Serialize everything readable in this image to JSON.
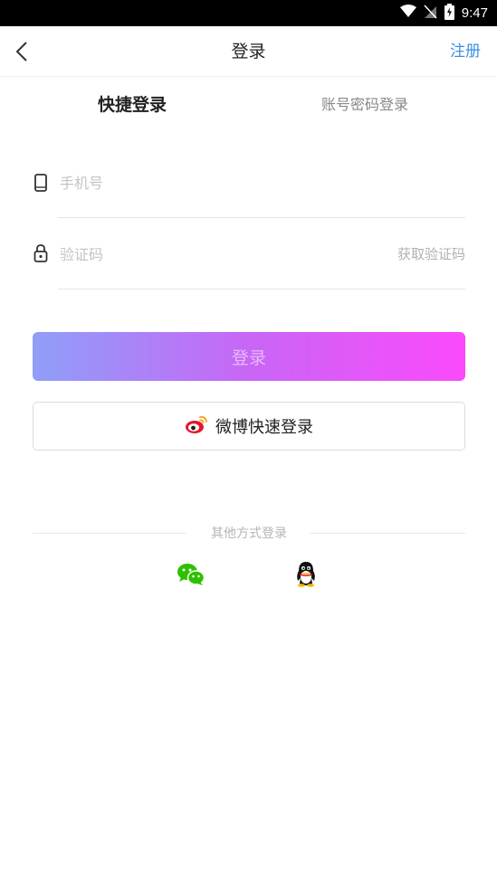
{
  "status_bar": {
    "time": "9:47"
  },
  "nav": {
    "title": "登录",
    "register": "注册"
  },
  "tabs": {
    "quick": "快捷登录",
    "password": "账号密码登录"
  },
  "form": {
    "phone_placeholder": "手机号",
    "code_placeholder": "验证码",
    "get_code": "获取验证码",
    "login_button": "登录"
  },
  "weibo": {
    "label": "微博快速登录"
  },
  "other": {
    "title": "其他方式登录"
  },
  "colors": {
    "accent": "#3d8fe3",
    "gradient_start": "#8f9ff8",
    "gradient_end": "#fb4afc",
    "wechat": "#2dc100"
  }
}
